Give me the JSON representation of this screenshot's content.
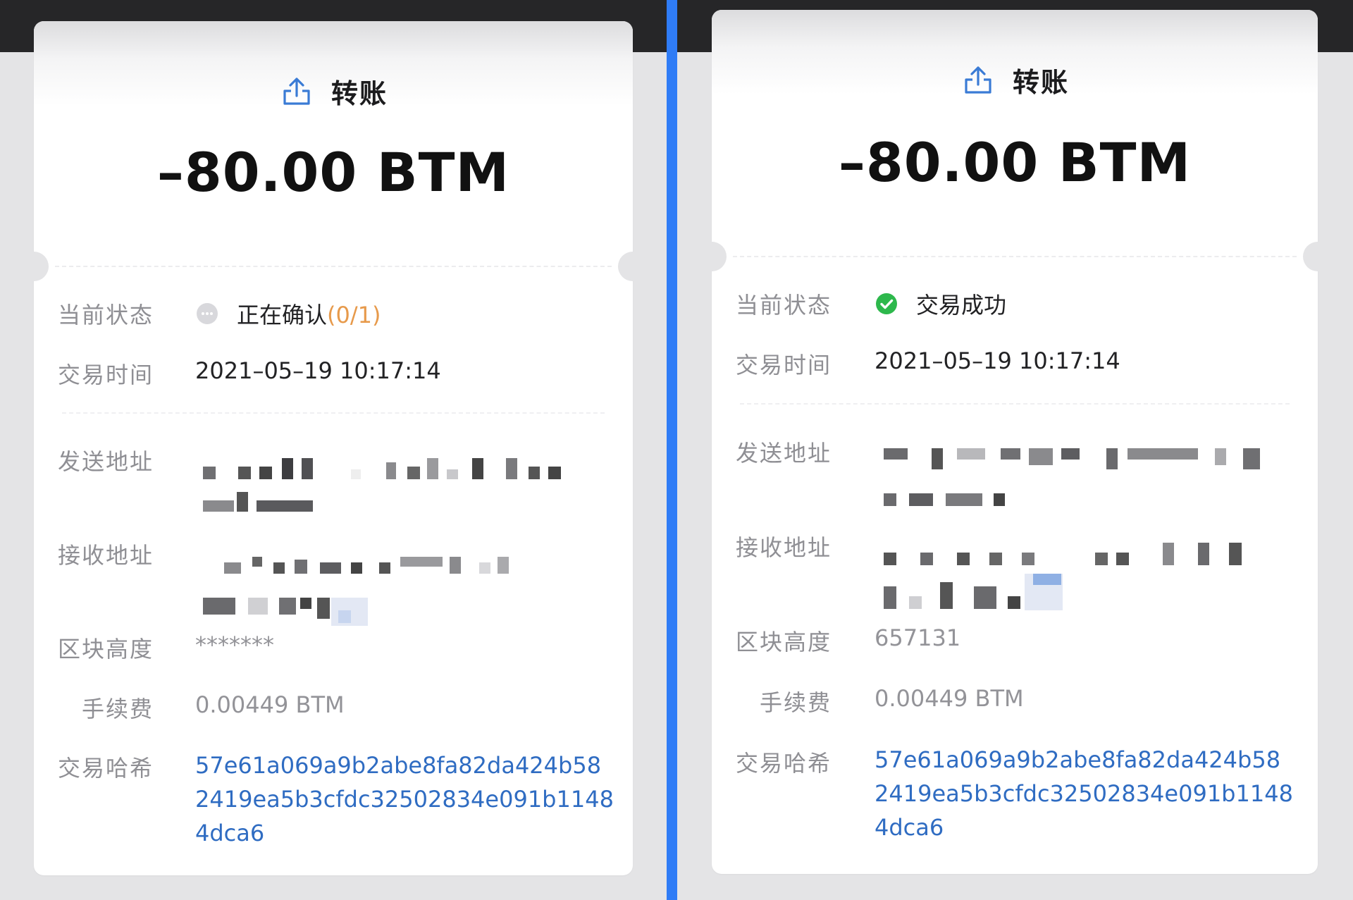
{
  "colors": {
    "accent_blue": "#2f7cf6",
    "link": "#2f6cc2",
    "pending": "#e79a4b",
    "success": "#2db84c"
  },
  "panels": [
    {
      "title": "转账",
      "amount": "–80.00 BTM",
      "labels": {
        "status": "当前状态",
        "time": "交易时间",
        "from": "发送地址",
        "to": "接收地址",
        "block": "区块高度",
        "fee": "手续费",
        "hash": "交易哈希"
      },
      "status_text": "正在确认",
      "status_progress": "(0/1)",
      "status_icon": "pending-dots-icon",
      "time": "2021–05–19 10:17:14",
      "block_height": "*******",
      "fee": "0.00449 BTM",
      "hash_lines": [
        "57e61a069a9b2abe8fa82da424b58",
        "2419ea5b3cfdc32502834e091b1148",
        "4dca6"
      ]
    },
    {
      "title": "转账",
      "amount": "–80.00 BTM",
      "labels": {
        "status": "当前状态",
        "time": "交易时间",
        "from": "发送地址",
        "to": "接收地址",
        "block": "区块高度",
        "fee": "手续费",
        "hash": "交易哈希"
      },
      "status_text": "交易成功",
      "status_icon": "success-check-icon",
      "time": "2021–05–19 10:17:14",
      "block_height": "657131",
      "fee": "0.00449 BTM",
      "hash_lines": [
        "57e61a069a9b2abe8fa82da424b58",
        "2419ea5b3cfdc32502834e091b1148",
        "4dca6"
      ]
    }
  ]
}
